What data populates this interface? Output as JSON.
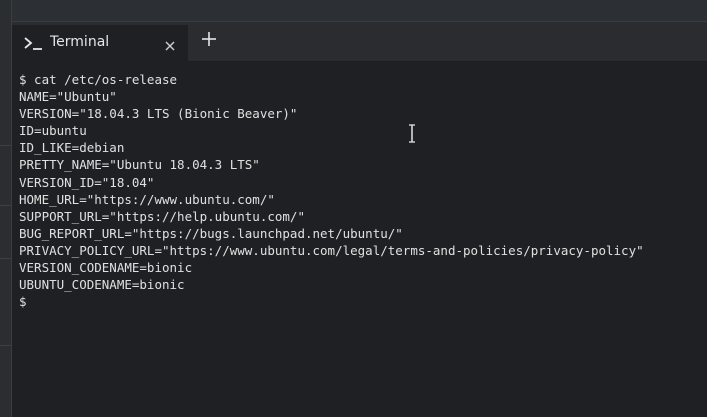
{
  "tab": {
    "label": "Terminal",
    "icon": "terminal-prompt-icon",
    "close_icon": "close-icon"
  },
  "new_tab_icon": "plus-icon",
  "terminal": {
    "lines": [
      "$ cat /etc/os-release",
      "NAME=\"Ubuntu\"",
      "VERSION=\"18.04.3 LTS (Bionic Beaver)\"",
      "ID=ubuntu",
      "ID_LIKE=debian",
      "PRETTY_NAME=\"Ubuntu 18.04.3 LTS\"",
      "VERSION_ID=\"18.04\"",
      "HOME_URL=\"https://www.ubuntu.com/\"",
      "SUPPORT_URL=\"https://help.ubuntu.com/\"",
      "BUG_REPORT_URL=\"https://bugs.launchpad.net/ubuntu/\"",
      "PRIVACY_POLICY_URL=\"https://www.ubuntu.com/legal/terms-and-policies/privacy-policy\"",
      "VERSION_CODENAME=bionic",
      "UBUNTU_CODENAME=bionic",
      "$"
    ]
  },
  "colors": {
    "background": "#1e2023",
    "tab_strip": "#2a2c30",
    "text": "#e0e0e0"
  }
}
